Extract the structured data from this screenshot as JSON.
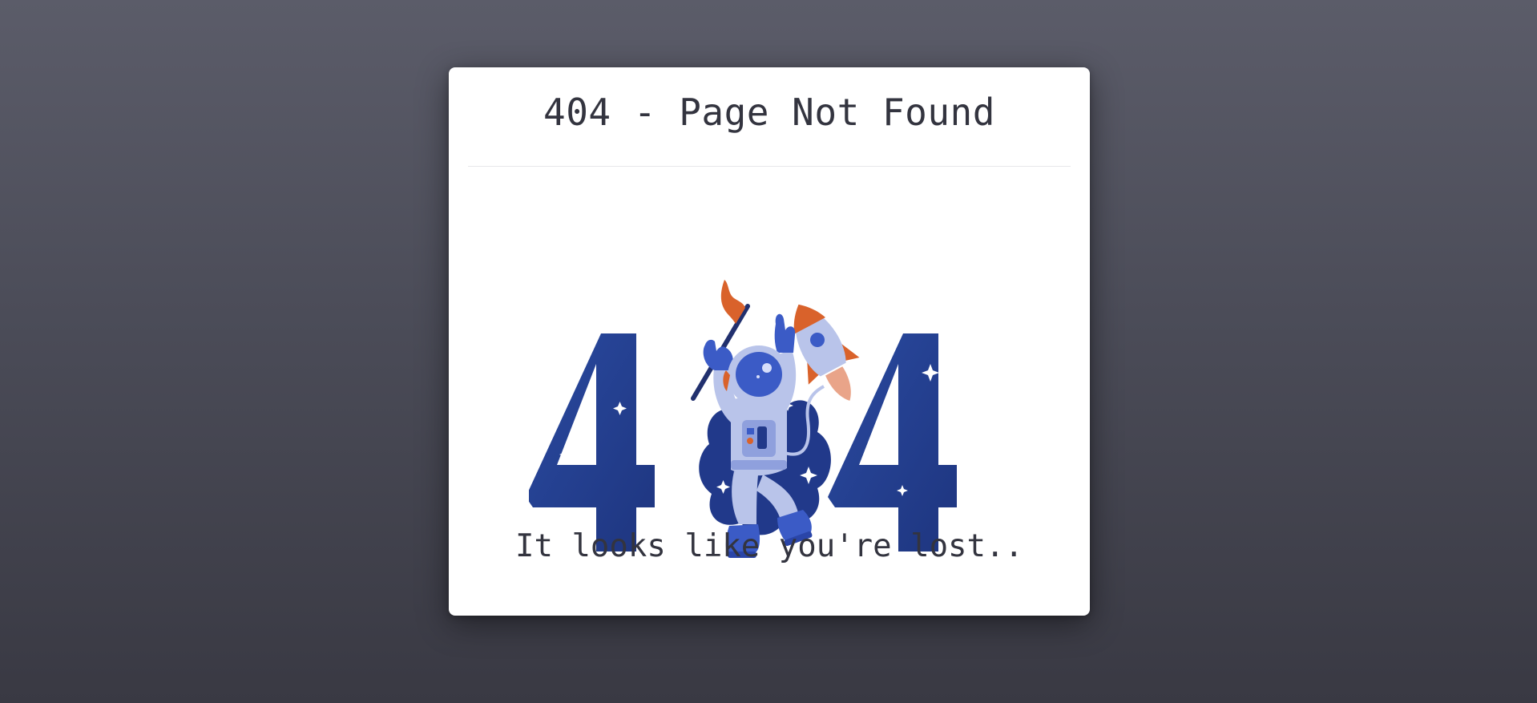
{
  "card": {
    "title": "404 - Page Not Found",
    "message": "It looks like you're lost.."
  },
  "illustration": {
    "subject": "astronaut holding flag between digits 4 and 4 with rocket",
    "icon": "astronaut-404-illustration"
  },
  "colors": {
    "background_top": "#5b5c69",
    "background_bottom": "#393943",
    "card": "#ffffff",
    "text": "#33343f",
    "digit_blue": "#233f8e",
    "suit_light": "#b9c4ea",
    "suit_blue": "#3b5bc6",
    "accent_orange": "#d9622b"
  }
}
